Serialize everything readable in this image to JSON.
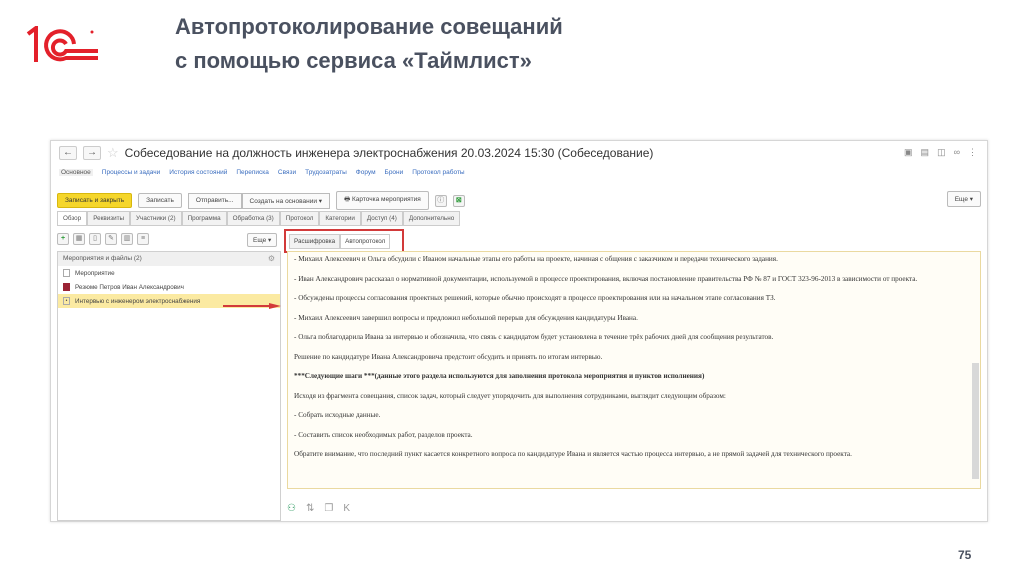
{
  "slide": {
    "title_line1": "Автопротоколирование совещаний",
    "title_line2": "с помощью сервиса «Таймлист»",
    "page_number": "75",
    "logo_text": "1С"
  },
  "window": {
    "title": "Собеседование на должность инженера электроснабжения 20.03.2024 15:30 (Собеседование)",
    "nav_back": "←",
    "nav_forward": "→",
    "links": [
      "Основное",
      "Процессы и задачи",
      "История состояний",
      "Переписка",
      "Связи",
      "Трудозатраты",
      "Форум",
      "Брони",
      "Протокол работы"
    ],
    "toolbar": {
      "save_close": "Записать и закрыть",
      "save": "Записать",
      "send": "Отправить...",
      "create_based": "Создать на основании ▾",
      "event_card": "Карточка мероприятия",
      "more": "Еще ▾"
    },
    "tabs": [
      "Обзор",
      "Реквизиты",
      "Участники (2)",
      "Программа",
      "Обработка (3)",
      "Протокол",
      "Категории",
      "Доступ (4)",
      "Дополнительно"
    ],
    "left_more": "Еще ▾",
    "left_panel": {
      "header": "Мероприятия и файлы (2)",
      "items": [
        "Мероприятие",
        "Резюме Петров Иван Александрович",
        "Интервью с инженером электроснабжения"
      ]
    },
    "subtabs": [
      "Расшифровка",
      "Автопротокол"
    ],
    "protocol_text": [
      "- Михаил Алексеевич и Ольга обсудили с Иваном начальные этапы его работы на проекте, начиная с общения с заказчиком и передачи технического задания.",
      "- Иван Александрович рассказал о нормативной документации, используемой в процессе проектирования, включая постановление правительства РФ № 87 и ГОСТ 323-96-2013 в зависимости от проекта.",
      "- Обсуждены процессы согласования проектных решений, которые обычно происходят в процессе проектирования или на начальном этапе согласования ТЗ.",
      "- Михаил Алексеевич завершил вопросы и предложил небольшой перерыв для обсуждения кандидатуры Ивана.",
      "- Ольга поблагодарила Ивана за интервью и обозначила, что связь с кандидатом будет установлена в течение трёх рабочих дней для сообщения результатов.",
      "Решение по кандидатуре Ивана Александровича предстоит обсудить и принять по итогам интервью.",
      "***Следующие шаги ***(данные этого раздела используются для заполнения протокола мероприятия и пунктов исполнения)",
      "Исходя из фрагмента совещания, список задач, который следует упорядочить для выполнения сотрудниками, выглядит следующим образом:",
      "- Собрать исходные данные.",
      "- Составить список необходимых работ, разделов проекта.",
      "Обратите внимание, что последний пункт касается конкретного вопроса по кандидатуре Ивана и является частью процесса интервью, а не прямой задачей для технического проекта."
    ]
  },
  "colors": {
    "accent_red": "#d23a3a",
    "primary_yellow": "#f5d62b",
    "title": "#4a5160",
    "link": "#3a6dbf"
  }
}
